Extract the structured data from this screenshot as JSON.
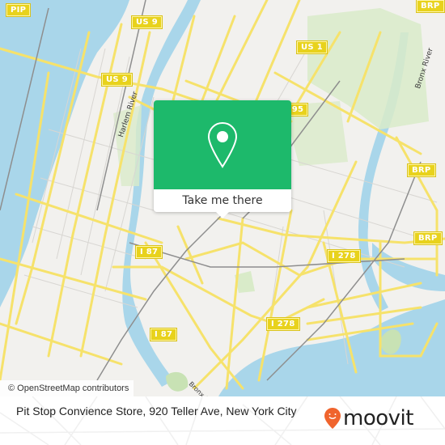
{
  "map": {
    "attribution": "© OpenStreetMap contributors",
    "road_shields": [
      {
        "id": "pip",
        "label": "PIP"
      },
      {
        "id": "us9-top",
        "label": "US 9"
      },
      {
        "id": "us9-mid",
        "label": "US 9"
      },
      {
        "id": "us1",
        "label": "US 1"
      },
      {
        "id": "i95",
        "label": "I 95"
      },
      {
        "id": "brp-top",
        "label": "BRP"
      },
      {
        "id": "brp-mid",
        "label": "BRP"
      },
      {
        "id": "brp-low",
        "label": "BRP"
      },
      {
        "id": "i87-mid",
        "label": "I 87"
      },
      {
        "id": "i87-low",
        "label": "I 87"
      },
      {
        "id": "i278-right",
        "label": "I 278"
      },
      {
        "id": "i278-low",
        "label": "I 278"
      }
    ],
    "water_labels": {
      "harlem_river": "Harlem River",
      "bronx_river": "Bronx River",
      "bronx_kill": "Bronx Kill"
    },
    "colors": {
      "water": "#a9d6ea",
      "land": "#f2f1ee",
      "park": "#d9ebc9",
      "road": "#f6e26b",
      "rail": "#8e8e8e",
      "shield": "#e8d21c"
    }
  },
  "popup": {
    "button_label": "Take me there",
    "accent_color": "#1db96b"
  },
  "footer": {
    "place_name": "Pit Stop Convience Store, 920 Teller Ave, New York City",
    "brand": "moovit",
    "brand_color": "#f0642d"
  }
}
